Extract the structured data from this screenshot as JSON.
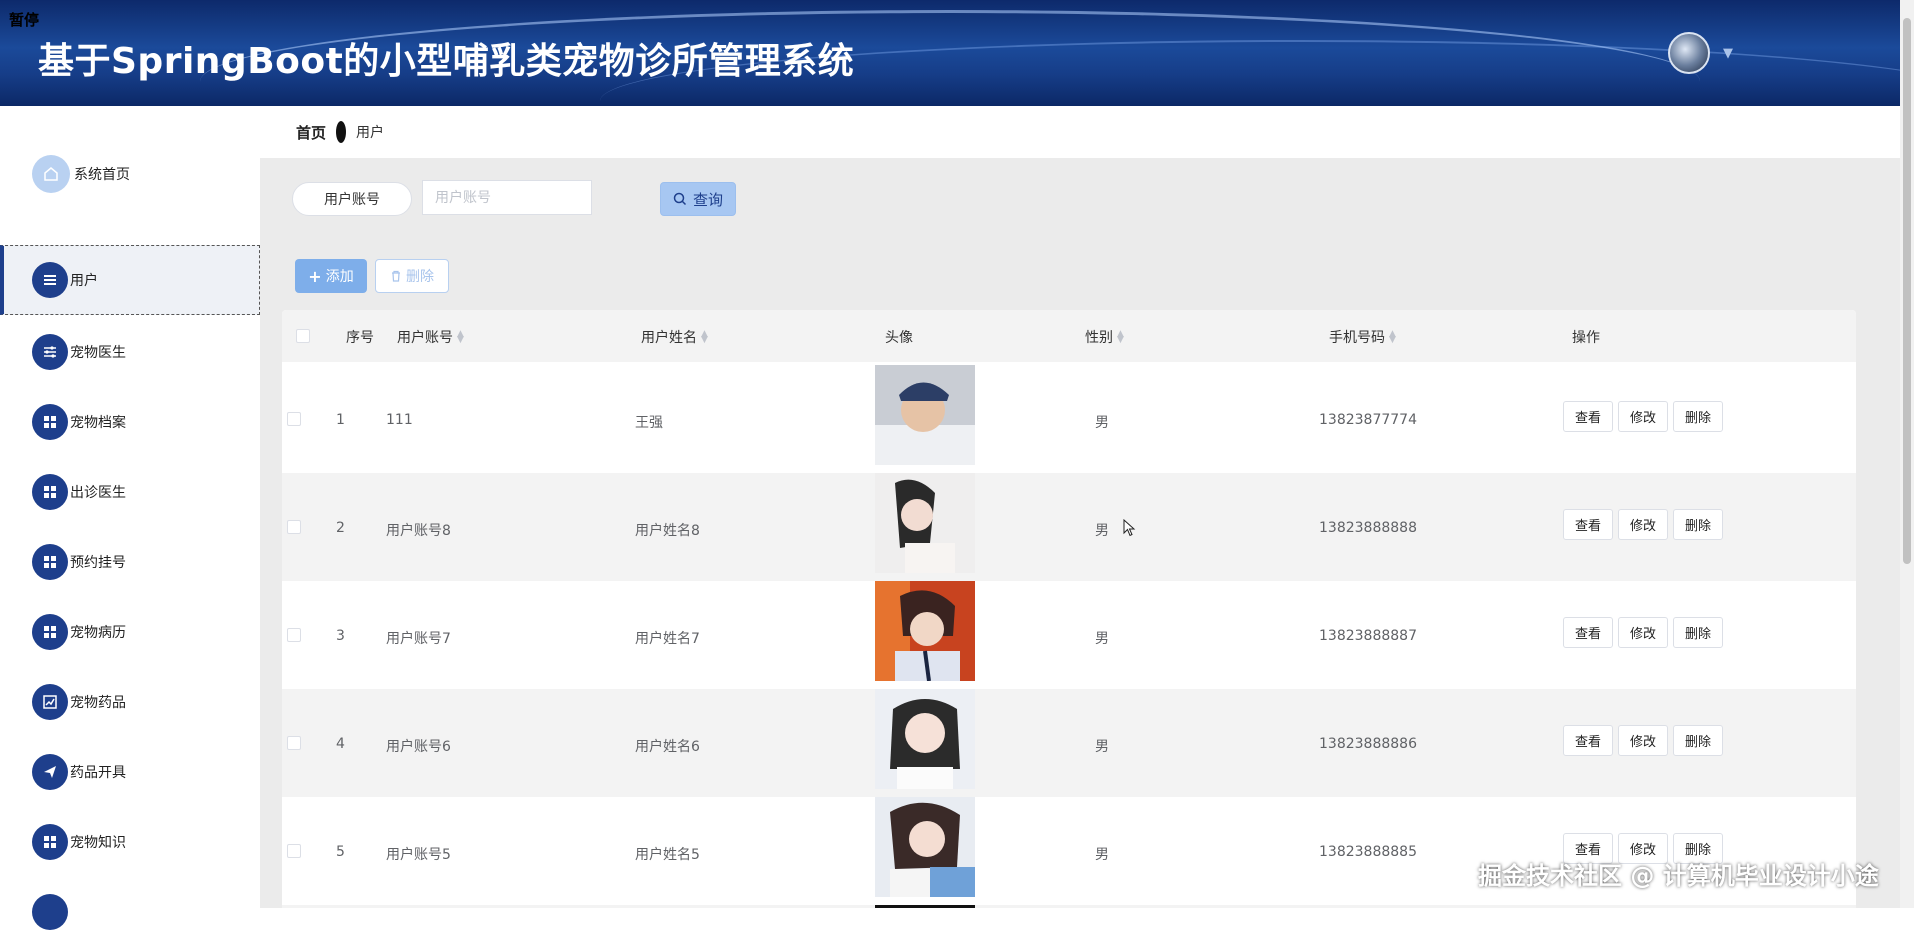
{
  "header": {
    "pause_label": "暂停",
    "title": "基于SpringBoot的小型哺乳类宠物诊所管理系统"
  },
  "sidebar": {
    "items": [
      {
        "label": "系统首页",
        "icon": "home-icon"
      },
      {
        "label": "用户",
        "icon": "list-icon"
      },
      {
        "label": "宠物医生",
        "icon": "sliders-icon"
      },
      {
        "label": "宠物档案",
        "icon": "grid-icon"
      },
      {
        "label": "出诊医生",
        "icon": "grid-icon"
      },
      {
        "label": "预约挂号",
        "icon": "grid-icon"
      },
      {
        "label": "宠物病历",
        "icon": "grid-icon"
      },
      {
        "label": "宠物药品",
        "icon": "chart-icon"
      },
      {
        "label": "药品开具",
        "icon": "send-icon"
      },
      {
        "label": "宠物知识",
        "icon": "grid-icon"
      }
    ],
    "active_index": 1
  },
  "breadcrumb": {
    "home": "首页",
    "current": "用户"
  },
  "search": {
    "label": "用户账号",
    "placeholder": "用户账号",
    "button": "查询"
  },
  "toolbar": {
    "add": "添加",
    "delete": "删除"
  },
  "table": {
    "columns": [
      "序号",
      "用户账号",
      "用户姓名",
      "头像",
      "性别",
      "手机号码",
      "操作"
    ],
    "rows": [
      {
        "index": "1",
        "account": "111",
        "name": "王强",
        "gender": "男",
        "phone": "13823877774"
      },
      {
        "index": "2",
        "account": "用户账号8",
        "name": "用户姓名8",
        "gender": "男",
        "phone": "13823888888"
      },
      {
        "index": "3",
        "account": "用户账号7",
        "name": "用户姓名7",
        "gender": "男",
        "phone": "13823888887"
      },
      {
        "index": "4",
        "account": "用户账号6",
        "name": "用户姓名6",
        "gender": "男",
        "phone": "13823888886"
      },
      {
        "index": "5",
        "account": "用户账号5",
        "name": "用户姓名5",
        "gender": "男",
        "phone": "13823888885"
      }
    ],
    "actions": {
      "view": "查看",
      "edit": "修改",
      "delete": "删除"
    }
  },
  "watermark": "掘金技术社区 @ 计算机毕业设计小途",
  "colors": {
    "header": "#163d88",
    "sidebar_icon": "#1e3f8c",
    "primary_light": "#7eaeea"
  }
}
